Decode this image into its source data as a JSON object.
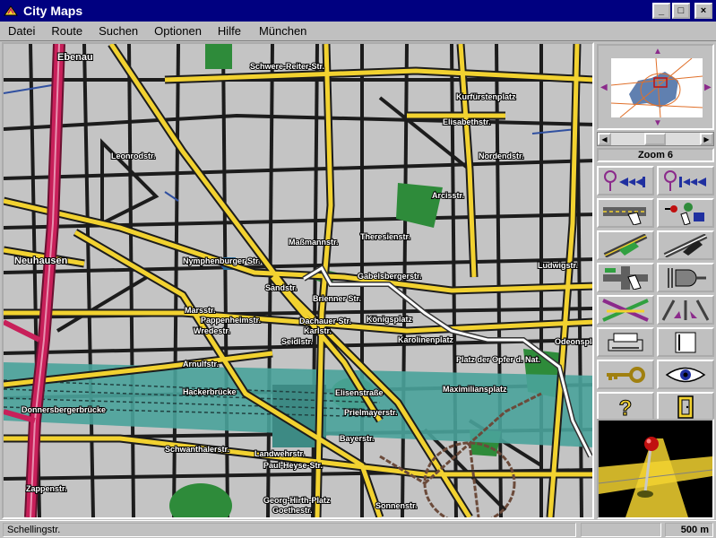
{
  "window": {
    "title": "City Maps",
    "controls": [
      "_",
      "□",
      "×"
    ]
  },
  "menu": {
    "items": [
      "Datei",
      "Route",
      "Suchen",
      "Optionen",
      "Hilfe"
    ],
    "region": "München"
  },
  "map": {
    "street_labels": [
      "Ebenau",
      "Schwere-Reiter-Str.",
      "Kurfürstenplatz",
      "Elisabethstr.",
      "Nordendstr.",
      "Leonrodstr.",
      "Arcisstr.",
      "Theresienstr.",
      "Maßmannstr.",
      "Nymphenburger Str.",
      "Neuhausen",
      "Gabelsbergerstr.",
      "Sandstr.",
      "Brienner Str.",
      "Ludwigstr.",
      "Pappenheimstr.",
      "Marsstr.",
      "Wredestr.",
      "Dachauer Str.",
      "Karlstr.",
      "Seidlstr.",
      "Königsplatz",
      "Karolinenplatz",
      "Platz der Opfer d. Nat.",
      "Odeonsplatz",
      "Arnulfstr.",
      "Hackerbrücke",
      "Donnersbergerbrücke",
      "Elisenstraße",
      "Maximiliansplatz",
      "Prielmayerstr.",
      "Bayerstr.",
      "Schwanthalerstr.",
      "Paul-Heyse-Str.",
      "Landwehrstr.",
      "Georg-Hirth-Platz",
      "Goethestr.",
      "Sonnenstr.",
      "Zappenstr."
    ]
  },
  "overview": {
    "arrows": [
      "▲",
      "▼",
      "◀",
      "▶"
    ]
  },
  "scrollbar": {
    "left": "◀",
    "right": "▶"
  },
  "zoom": {
    "label": "Zoom 6"
  },
  "tools": {
    "items": [
      "route-start-tool",
      "route-destination-tool",
      "street-view-tool",
      "poi-info-tool",
      "route-area-tool",
      "night-route-tool",
      "intersection-tool",
      "tunnel-tool",
      "block-route-tool",
      "lanes-tool",
      "print-tool",
      "panel-tool",
      "key-tool",
      "eye-view-tool",
      "help-tool",
      "exit-tool"
    ]
  },
  "statusbar": {
    "street": "Schellingstr.",
    "scale": "500 m"
  },
  "colors": {
    "titlebar": "#000080",
    "major_road": "#f2d230",
    "minor_road": "#1c1c1c",
    "park": "#2e8b3a",
    "river": "#4aa39b",
    "motorway": "#c8205a",
    "route": "#ffffff",
    "tram": "#6b4a3a"
  }
}
